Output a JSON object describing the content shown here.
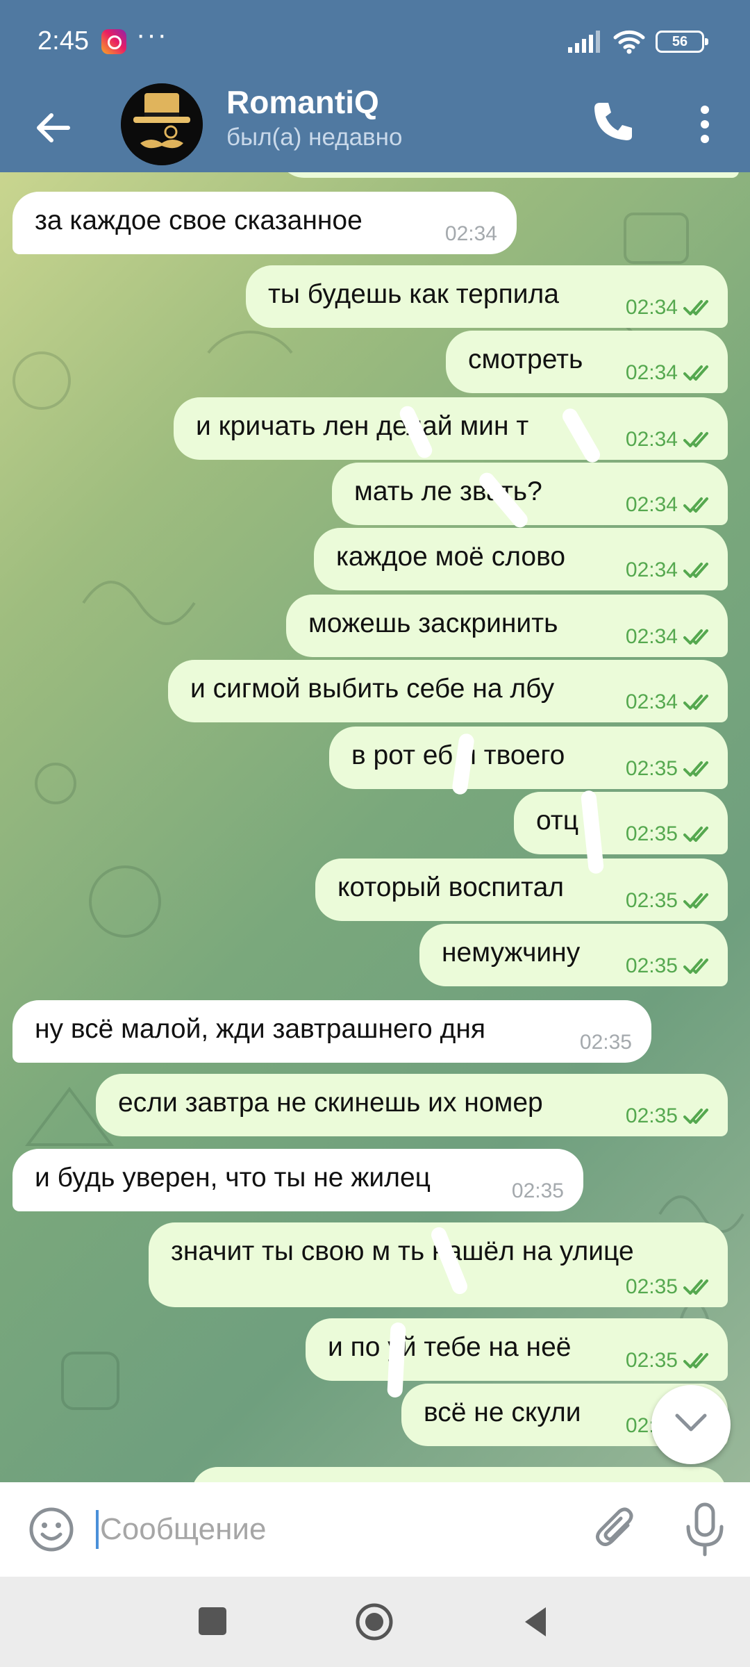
{
  "status_bar": {
    "time": "2:45",
    "more_indicator": "···",
    "battery_level": "56",
    "icons": [
      "instagram-icon",
      "signal-icon",
      "wifi-icon",
      "battery-icon"
    ]
  },
  "header": {
    "title": "RomantiQ",
    "status": "был(а) недавно",
    "icons": [
      "back-arrow-icon",
      "phone-icon",
      "more-vertical-icon"
    ]
  },
  "messages": [
    {
      "dir": "in",
      "text": "за каждое свое сказанное",
      "time": "02:34"
    },
    {
      "dir": "out",
      "text": "ты будешь как терпила",
      "time": "02:34"
    },
    {
      "dir": "out",
      "text": "смотреть",
      "time": "02:34"
    },
    {
      "dir": "out",
      "text": "и кричать лен  делай мин  т",
      "time": "02:34"
    },
    {
      "dir": "out",
      "text": "мать ле   звать?",
      "time": "02:34"
    },
    {
      "dir": "out",
      "text": "каждое моё слово",
      "time": "02:34"
    },
    {
      "dir": "out",
      "text": "можешь заскринить",
      "time": "02:34"
    },
    {
      "dir": "out",
      "text": "и сигмой выбить себе на лбу",
      "time": "02:34"
    },
    {
      "dir": "out",
      "text": "в рот еб  л твоего",
      "time": "02:35"
    },
    {
      "dir": "out",
      "text": "отц",
      "time": "02:35"
    },
    {
      "dir": "out",
      "text": "который воспитал",
      "time": "02:35"
    },
    {
      "dir": "out",
      "text": "немужчину",
      "time": "02:35"
    },
    {
      "dir": "in",
      "text": "ну всё малой, жди завтрашнего дня",
      "time": "02:35"
    },
    {
      "dir": "out",
      "text": "если завтра не скинешь их номер",
      "time": "02:35"
    },
    {
      "dir": "in",
      "text": "и будь уверен, что ты не жилец",
      "time": "02:35"
    },
    {
      "dir": "out",
      "text": "значит ты свою м  ть нашёл на улице",
      "time": "02:35"
    },
    {
      "dir": "out",
      "text": "и по  уй тебе на неё",
      "time": "02:35"
    },
    {
      "dir": "out",
      "text": "всё не скули",
      "time": "02:35"
    }
  ],
  "input": {
    "placeholder": "Сообщение",
    "icons": [
      "emoji-icon",
      "paperclip-icon",
      "microphone-icon"
    ]
  },
  "nav": {
    "icons": [
      "recent-apps-icon",
      "home-icon",
      "back-icon"
    ]
  },
  "colors": {
    "header": "#5079a1",
    "outgoing_bubble": "#ebfbd9",
    "incoming_bubble": "#ffffff",
    "outgoing_time": "#55a84f",
    "incoming_time": "#a4a9ad"
  }
}
